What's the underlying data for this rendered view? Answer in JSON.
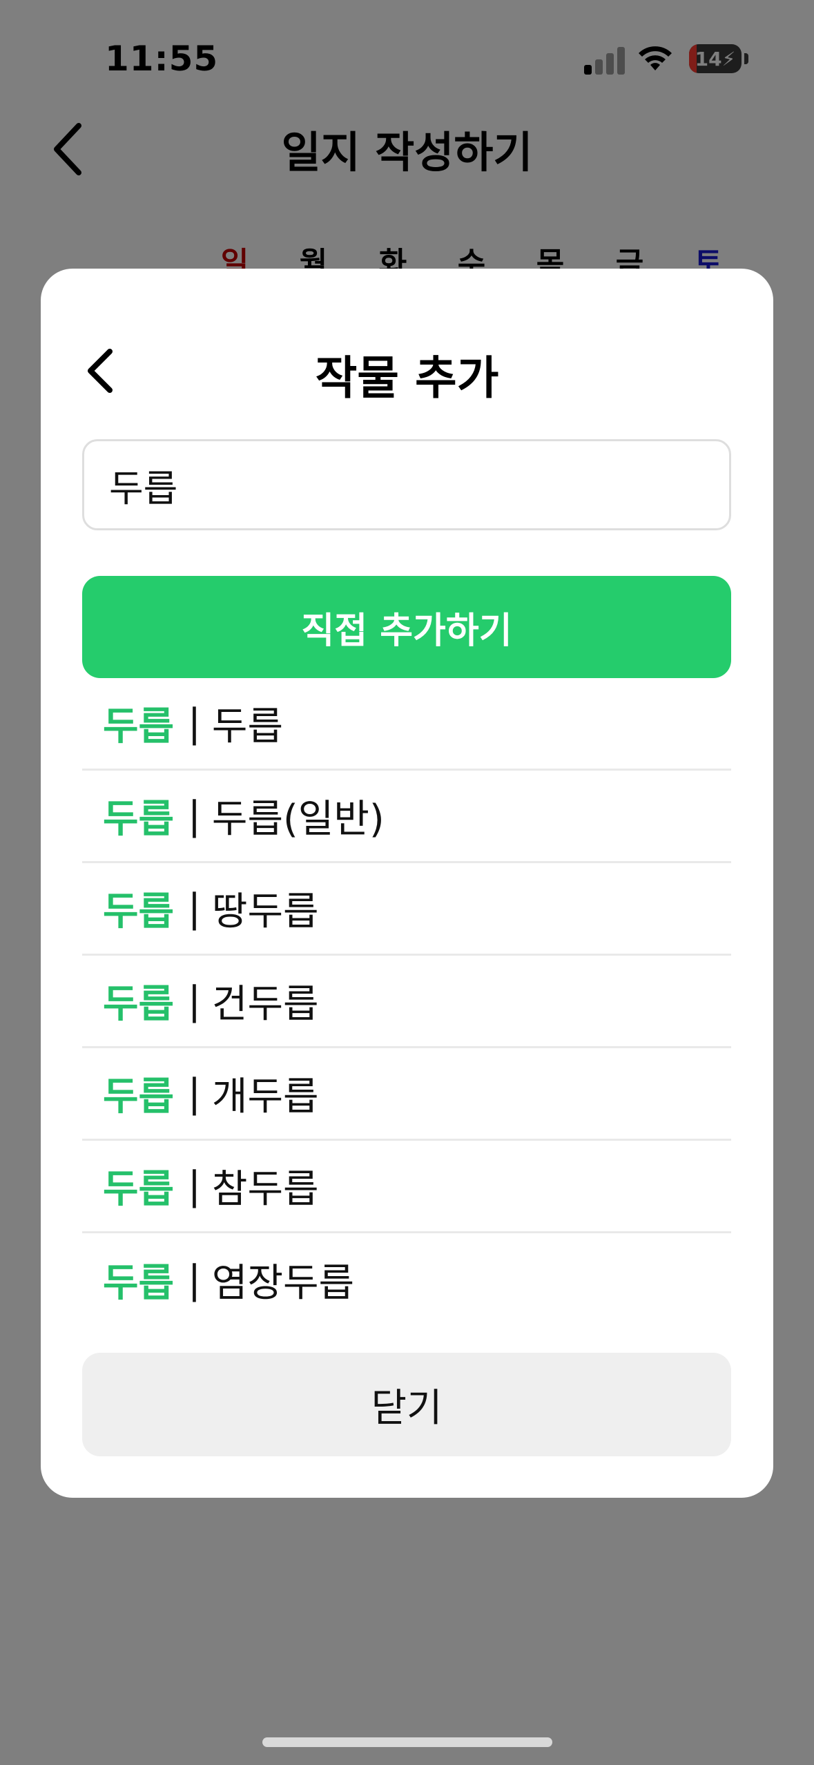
{
  "status_bar": {
    "time": "11:55",
    "battery_level": "14",
    "icons": [
      "cellular-signal-icon",
      "wifi-icon",
      "battery-charging-icon"
    ]
  },
  "header": {
    "back_icon": "chevron-left-icon",
    "title": "일지 작성하기"
  },
  "weekdays": [
    {
      "label": "일",
      "color": "#c00000"
    },
    {
      "label": "월",
      "color": "#000000"
    },
    {
      "label": "화",
      "color": "#000000"
    },
    {
      "label": "수",
      "color": "#000000"
    },
    {
      "label": "목",
      "color": "#000000"
    },
    {
      "label": "금",
      "color": "#000000"
    },
    {
      "label": "토",
      "color": "#1a1ad0"
    }
  ],
  "modal": {
    "back_icon": "chevron-left-icon",
    "title": "작물 추가",
    "search": {
      "value": "두릅",
      "placeholder": ""
    },
    "add_button_label": "직접 추가하기",
    "results": [
      {
        "category": "두릅",
        "separator": "|",
        "name": "두릅"
      },
      {
        "category": "두릅",
        "separator": "|",
        "name": "두릅(일반)"
      },
      {
        "category": "두릅",
        "separator": "|",
        "name": "땅두릅"
      },
      {
        "category": "두릅",
        "separator": "|",
        "name": "건두릅"
      },
      {
        "category": "두릅",
        "separator": "|",
        "name": "개두릅"
      },
      {
        "category": "두릅",
        "separator": "|",
        "name": "참두릅"
      },
      {
        "category": "두릅",
        "separator": "|",
        "name": "염장두릅"
      }
    ],
    "close_button_label": "닫기"
  },
  "colors": {
    "accent_green": "#25cc6c",
    "highlight_text_green": "#25c06a",
    "overlay": "rgba(0,0,0,0.5)",
    "close_button_bg": "#efefef"
  }
}
